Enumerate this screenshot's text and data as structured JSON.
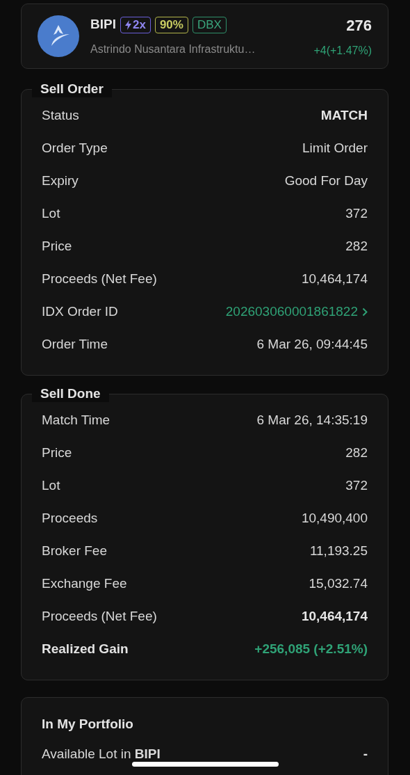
{
  "stock": {
    "ticker": "BIPI",
    "badges": [
      {
        "kind": "margin",
        "text": "2x"
      },
      {
        "kind": "ratio",
        "text": "90%"
      },
      {
        "kind": "board",
        "text": "DBX"
      }
    ],
    "name": "Astrindo Nusantara Infrastruktu…",
    "price": "276",
    "change": "+4(+1.47%)"
  },
  "sections": [
    {
      "title": "Sell Order",
      "rows": [
        {
          "kind": "strong",
          "label": "Status",
          "value": "MATCH"
        },
        {
          "kind": "plain",
          "label": "Order Type",
          "value": "Limit Order"
        },
        {
          "kind": "plain",
          "label": "Expiry",
          "value": "Good For Day"
        },
        {
          "kind": "plain",
          "label": "Lot",
          "value": "372"
        },
        {
          "kind": "plain",
          "label": "Price",
          "value": "282"
        },
        {
          "kind": "plain",
          "label": "Proceeds (Net Fee)",
          "value": "10,464,174"
        },
        {
          "kind": "link",
          "label": "IDX Order ID",
          "value": "202603060001861822"
        },
        {
          "kind": "plain",
          "label": "Order Time",
          "value": "6 Mar 26, 09:44:45"
        }
      ]
    },
    {
      "title": "Sell Done",
      "rows": [
        {
          "kind": "plain",
          "label": "Match Time",
          "value": "6 Mar 26, 14:35:19"
        },
        {
          "kind": "plain",
          "label": "Price",
          "value": "282"
        },
        {
          "kind": "plain",
          "label": "Lot",
          "value": "372"
        },
        {
          "kind": "plain",
          "label": "Proceeds",
          "value": "10,490,400"
        },
        {
          "kind": "plain",
          "label": "Broker Fee",
          "value": "11,193.25"
        },
        {
          "kind": "plain",
          "label": "Exchange Fee",
          "value": "15,032.74"
        },
        {
          "kind": "strong",
          "label": "Proceeds (Net Fee)",
          "value": "10,464,174"
        },
        {
          "kind": "gain",
          "label": "Realized Gain",
          "value": "+256,085 (+2.51%)"
        }
      ]
    }
  ],
  "portfolio": {
    "title": "In My Portfolio",
    "rows": [
      {
        "label": "Available Lot in **BIPI**",
        "value": "-"
      }
    ]
  }
}
